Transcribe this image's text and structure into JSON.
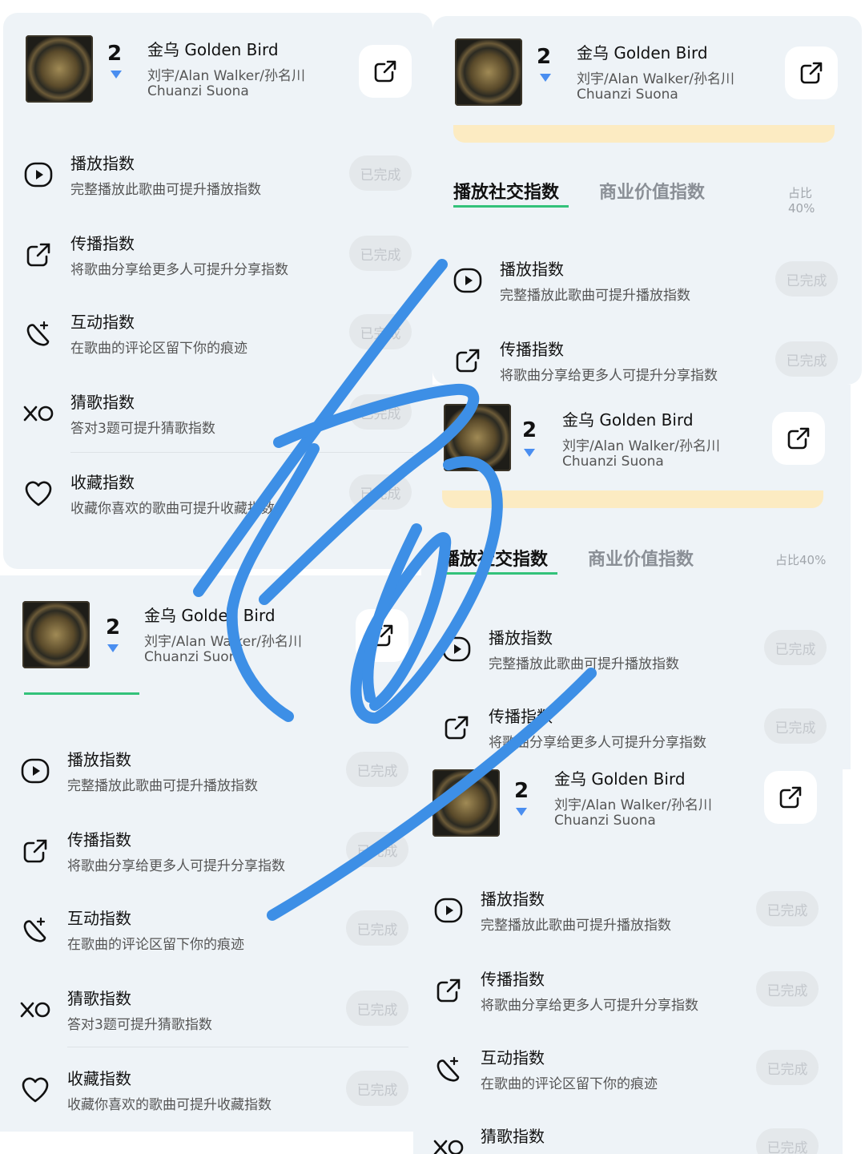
{
  "song": {
    "rank": "2",
    "title": "金乌 Golden Bird",
    "artists": "刘宇/Alan Walker/孙名川",
    "album": "Chuanzi Suona"
  },
  "tabs": {
    "active": "播放社交指数",
    "inactive": "商业价值指数",
    "share_pct": "占比40%"
  },
  "tasks": [
    {
      "title": "播放指数",
      "desc": "完整播放此歌曲可提升播放指数",
      "icon": "play-icon",
      "status": "已完成"
    },
    {
      "title": "传播指数",
      "desc": "将歌曲分享给更多人可提升分享指数",
      "icon": "share-icon",
      "status": "已完成"
    },
    {
      "title": "互动指数",
      "desc": "在歌曲的评论区留下你的痕迹",
      "icon": "comment-sparkle-icon",
      "status": "已完成"
    },
    {
      "title": "猜歌指数",
      "desc": "答对3题可提升猜歌指数",
      "icon": "xo-icon",
      "status": "已完成"
    },
    {
      "title": "收藏指数",
      "desc": "收藏你喜欢的歌曲可提升收藏指数",
      "icon": "heart-icon",
      "status": "已完成"
    }
  ],
  "colors": {
    "accent_blue": "#4a8ef0",
    "tab_underline": "#33c27a",
    "banner_yellow": "#fcebc2",
    "scribble_blue": "#3d8fe6"
  }
}
